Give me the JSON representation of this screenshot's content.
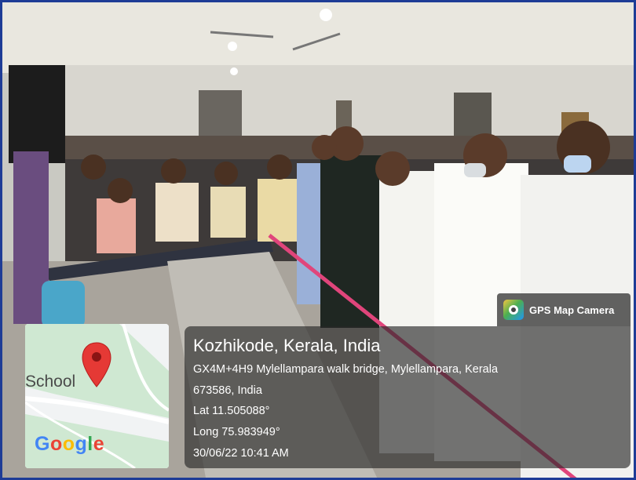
{
  "overlay": {
    "app_badge": "GPS Map Camera",
    "title": "Kozhikode, Kerala, India",
    "address_line1": "GX4M+4H9 Mylellampara walk bridge, Mylellampara, Kerala",
    "address_line2": "673586, India",
    "latitude": "Lat 11.505088°",
    "longitude": "Long 75.983949°",
    "datetime": "30/06/22 10:41 AM"
  },
  "map": {
    "place_label": "School",
    "logo_text": "Google",
    "pin_icon": "map-pin-icon"
  },
  "colors": {
    "frame": "#1e3c96",
    "ribbon": "#e0457b",
    "pin": "#e53935"
  }
}
